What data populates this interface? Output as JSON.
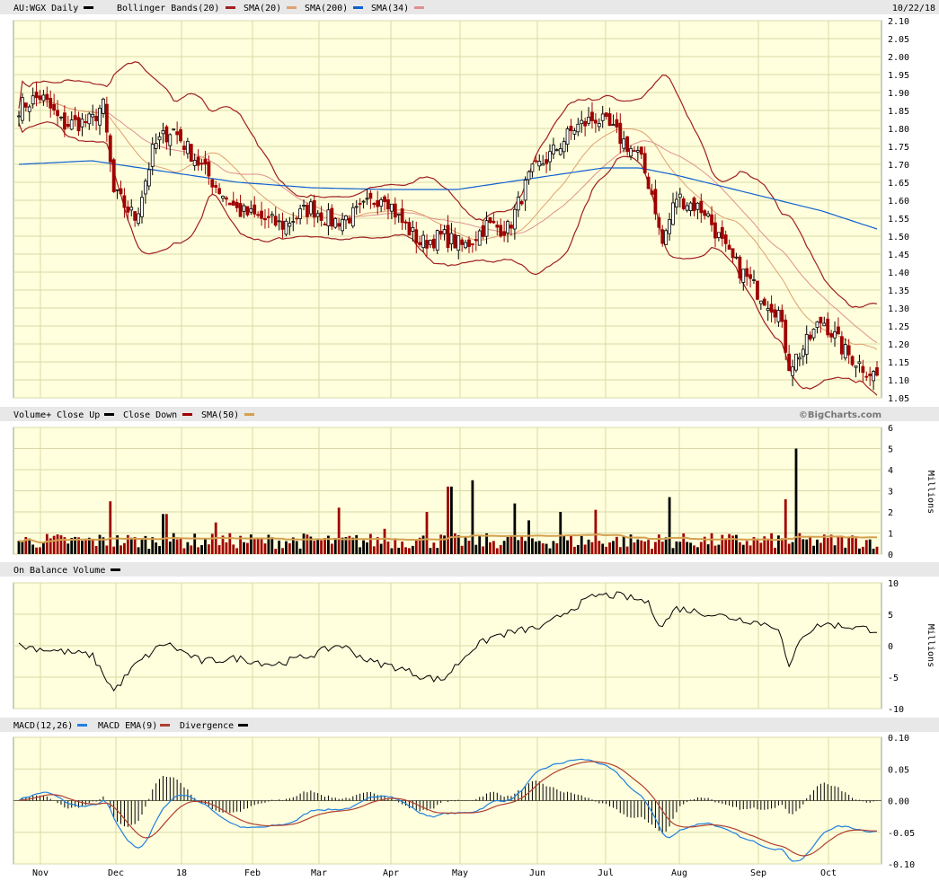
{
  "header": {
    "symbol_label": "AU:WGX Daily",
    "bb_label": "Bollinger Bands(20)",
    "sma20_label": "SMA(20)",
    "sma200_label": "SMA(200)",
    "sma34_label": "SMA(34)",
    "date": "10/22/18"
  },
  "watermark": "©BigCharts.com",
  "volume_header": {
    "up_label": "Volume+ Close Up",
    "down_label": "Close Down",
    "sma_label": "SMA(50)"
  },
  "obv_header": {
    "label": "On Balance Volume"
  },
  "macd_header": {
    "macd_label": "MACD(12,26)",
    "ema_label": "MACD EMA(9)",
    "div_label": "Divergence"
  },
  "colors": {
    "panel_bg": "#ffffdd",
    "grid": "#d8d8a8",
    "up": "#000000",
    "down": "#a00000",
    "bollinger": "#a02020",
    "sma20": "#e0a070",
    "sma200": "#1060d0",
    "sma34": "#e09090",
    "vol_sma": "#d4a050",
    "macd": "#2080e0",
    "macd_ema": "#b04030"
  },
  "chart_data": [
    {
      "type": "candlestick",
      "title": "AU:WGX Daily",
      "x_labels": [
        "Nov",
        "Dec",
        "18",
        "Feb",
        "Mar",
        "Apr",
        "May",
        "Jun",
        "Jul",
        "Aug",
        "Sep",
        "Oct"
      ],
      "y_ticks": [
        "2.10",
        "2.05",
        "2.00",
        "1.95",
        "1.90",
        "1.85",
        "1.80",
        "1.75",
        "1.70",
        "1.65",
        "1.60",
        "1.55",
        "1.50",
        "1.45",
        "1.40",
        "1.35",
        "1.30",
        "1.25",
        "1.20",
        "1.15",
        "1.10",
        "1.05"
      ],
      "ylim": [
        1.05,
        2.1
      ],
      "close_anchors": [
        {
          "month": 0.0,
          "value": 1.86
        },
        {
          "month": 0.3,
          "value": 1.89
        },
        {
          "month": 0.6,
          "value": 1.81
        },
        {
          "month": 1.0,
          "value": 1.82
        },
        {
          "month": 1.15,
          "value": 1.87
        },
        {
          "month": 1.3,
          "value": 1.62
        },
        {
          "month": 1.6,
          "value": 1.55
        },
        {
          "month": 1.85,
          "value": 1.75
        },
        {
          "month": 2.1,
          "value": 1.8
        },
        {
          "month": 2.4,
          "value": 1.72
        },
        {
          "month": 2.7,
          "value": 1.64
        },
        {
          "month": 3.0,
          "value": 1.57
        },
        {
          "month": 3.3,
          "value": 1.55
        },
        {
          "month": 3.6,
          "value": 1.53
        },
        {
          "month": 4.0,
          "value": 1.58
        },
        {
          "month": 4.3,
          "value": 1.54
        },
        {
          "month": 4.6,
          "value": 1.56
        },
        {
          "month": 5.0,
          "value": 1.62
        },
        {
          "month": 5.2,
          "value": 1.55
        },
        {
          "month": 5.5,
          "value": 1.48
        },
        {
          "month": 5.8,
          "value": 1.5
        },
        {
          "month": 6.1,
          "value": 1.47
        },
        {
          "month": 6.4,
          "value": 1.53
        },
        {
          "month": 6.7,
          "value": 1.52
        },
        {
          "month": 7.0,
          "value": 1.67
        },
        {
          "month": 7.3,
          "value": 1.73
        },
        {
          "month": 7.6,
          "value": 1.8
        },
        {
          "month": 7.9,
          "value": 1.83
        },
        {
          "month": 8.1,
          "value": 1.8
        },
        {
          "month": 8.5,
          "value": 1.72
        },
        {
          "month": 8.7,
          "value": 1.6
        },
        {
          "month": 8.8,
          "value": 1.47
        },
        {
          "month": 9.0,
          "value": 1.61
        },
        {
          "month": 9.4,
          "value": 1.57
        },
        {
          "month": 9.7,
          "value": 1.45
        },
        {
          "month": 10.1,
          "value": 1.35
        },
        {
          "month": 10.4,
          "value": 1.29
        },
        {
          "month": 10.55,
          "value": 1.14
        },
        {
          "month": 10.75,
          "value": 1.19
        },
        {
          "month": 11.0,
          "value": 1.27
        },
        {
          "month": 11.3,
          "value": 1.18
        },
        {
          "month": 11.6,
          "value": 1.13
        },
        {
          "month": 11.75,
          "value": 1.11
        }
      ],
      "sma200_anchors": [
        {
          "month": 0.0,
          "value": 1.7
        },
        {
          "month": 1.0,
          "value": 1.71
        },
        {
          "month": 2.0,
          "value": 1.68
        },
        {
          "month": 3.0,
          "value": 1.65
        },
        {
          "month": 4.0,
          "value": 1.635
        },
        {
          "month": 5.0,
          "value": 1.63
        },
        {
          "month": 6.0,
          "value": 1.63
        },
        {
          "month": 7.0,
          "value": 1.66
        },
        {
          "month": 8.0,
          "value": 1.69
        },
        {
          "month": 8.5,
          "value": 1.69
        },
        {
          "month": 9.0,
          "value": 1.67
        },
        {
          "month": 10.0,
          "value": 1.62
        },
        {
          "month": 11.0,
          "value": 1.57
        },
        {
          "month": 11.75,
          "value": 1.52
        }
      ]
    },
    {
      "type": "bar",
      "title": "Volume+ Close Up / Close Down",
      "ylabel": "Millions",
      "y_ticks": [
        "6",
        "5",
        "4",
        "3",
        "2",
        "1",
        "0"
      ],
      "ylim": [
        0,
        6
      ],
      "sma50_value_approx": 0.8,
      "spikes": [
        {
          "month": 1.25,
          "value": 2.5
        },
        {
          "month": 2.0,
          "value": 1.9
        },
        {
          "month": 2.7,
          "value": 1.5
        },
        {
          "month": 4.4,
          "value": 2.2
        },
        {
          "month": 5.0,
          "value": 1.2
        },
        {
          "month": 5.6,
          "value": 2.0
        },
        {
          "month": 5.9,
          "value": 3.2
        },
        {
          "month": 6.2,
          "value": 3.5
        },
        {
          "month": 6.8,
          "value": 2.4
        },
        {
          "month": 7.0,
          "value": 1.6
        },
        {
          "month": 7.4,
          "value": 2.0
        },
        {
          "month": 7.9,
          "value": 2.1
        },
        {
          "month": 8.9,
          "value": 2.7
        },
        {
          "month": 10.5,
          "value": 2.6
        },
        {
          "month": 10.65,
          "value": 5.0
        }
      ]
    },
    {
      "type": "line",
      "title": "On Balance Volume",
      "ylabel": "Millions",
      "y_ticks": [
        "10",
        "5",
        "0",
        "-5",
        "-10"
      ],
      "ylim": [
        -10,
        10
      ],
      "anchors": [
        {
          "month": 0.0,
          "value": 0.0
        },
        {
          "month": 0.5,
          "value": -0.8
        },
        {
          "month": 1.0,
          "value": -1.5
        },
        {
          "month": 1.3,
          "value": -7.2
        },
        {
          "month": 1.6,
          "value": -3.0
        },
        {
          "month": 2.0,
          "value": 0.5
        },
        {
          "month": 2.5,
          "value": -2.5
        },
        {
          "month": 3.0,
          "value": -2.0
        },
        {
          "month": 3.5,
          "value": -3.0
        },
        {
          "month": 4.0,
          "value": -1.5
        },
        {
          "month": 4.4,
          "value": 0.2
        },
        {
          "month": 4.8,
          "value": -2.5
        },
        {
          "month": 5.2,
          "value": -3.5
        },
        {
          "month": 5.5,
          "value": -4.8
        },
        {
          "month": 5.8,
          "value": -5.5
        },
        {
          "month": 6.2,
          "value": -0.5
        },
        {
          "month": 6.5,
          "value": 1.5
        },
        {
          "month": 6.9,
          "value": 2.5
        },
        {
          "month": 7.2,
          "value": 3.0
        },
        {
          "month": 7.5,
          "value": 5.5
        },
        {
          "month": 7.9,
          "value": 8.0
        },
        {
          "month": 8.2,
          "value": 8.0
        },
        {
          "month": 8.6,
          "value": 7.0
        },
        {
          "month": 8.8,
          "value": 3.0
        },
        {
          "month": 9.0,
          "value": 6.0
        },
        {
          "month": 9.5,
          "value": 5.0
        },
        {
          "month": 10.0,
          "value": 4.0
        },
        {
          "month": 10.4,
          "value": 3.0
        },
        {
          "month": 10.55,
          "value": -4.0
        },
        {
          "month": 10.7,
          "value": 1.5
        },
        {
          "month": 11.0,
          "value": 3.5
        },
        {
          "month": 11.4,
          "value": 3.0
        },
        {
          "month": 11.75,
          "value": 2.5
        }
      ]
    },
    {
      "type": "line",
      "title": "MACD(12,26) / MACD EMA(9) / Divergence",
      "y_ticks": [
        "0.10",
        "0.05",
        "0.00",
        "-0.05",
        "-0.10"
      ],
      "ylim": [
        -0.1,
        0.1
      ]
    }
  ]
}
